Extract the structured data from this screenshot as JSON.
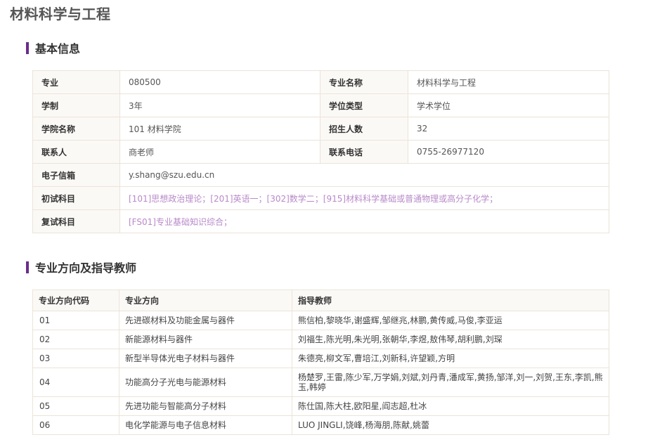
{
  "page": {
    "title": "材料科学与工程"
  },
  "basic_info": {
    "section_title": "基本信息",
    "rows": [
      {
        "l1": "专业",
        "v1": "080500",
        "l2": "专业名称",
        "v2": "材料科学与工程"
      },
      {
        "l1": "学制",
        "v1": "3年",
        "l2": "学位类型",
        "v2": "学术学位"
      },
      {
        "l1": "学院名称",
        "v1": "101 材料学院",
        "l2": "招生人数",
        "v2": "32"
      },
      {
        "l1": "联系人",
        "v1": "商老师",
        "l2": "联系电话",
        "v2": "0755-26977120"
      }
    ],
    "email_label": "电子信箱",
    "email": "y.shang@szu.edu.cn",
    "initial_exam_label": "初试科目",
    "initial_exam": "[101]思想政治理论；[201]英语一；[302]数学二；[915]材料科学基础或普通物理或高分子化学；",
    "retest_label": "复试科目",
    "retest": "[FS01]专业基础知识综合；"
  },
  "directions": {
    "section_title": "专业方向及指导教师",
    "headers": [
      "专业方向代码",
      "专业方向",
      "指导教师"
    ],
    "rows": [
      {
        "code": "01",
        "name": "先进碳材料及功能金属与器件",
        "advisors": "熊信柏,黎晓华,谢盛辉,邹继兆,林鹏,黄传威,马俊,李亚运"
      },
      {
        "code": "02",
        "name": "新能源材料与器件",
        "advisors": "刘福生,陈光明,朱光明,张朝华,李煜,敖伟琴,胡利鹏,刘琛"
      },
      {
        "code": "03",
        "name": "新型半导体光电子材料与器件",
        "advisors": "朱德亮,柳文军,曹培江,刘新科,许望颖,方明"
      },
      {
        "code": "04",
        "name": "功能高分子光电与能源材料",
        "advisors": "杨楚罗,王雷,陈少军,万学娟,刘斌,刘丹青,潘成军,黄扬,邹洋,刘一,刘贺,王东,李凯,熊玉,韩婷"
      },
      {
        "code": "05",
        "name": "先进功能与智能高分子材料",
        "advisors": "陈仕国,陈大柱,欧阳星,阎志超,杜冰"
      },
      {
        "code": "06",
        "name": "电化学能源与电子信息材料",
        "advisors": "LUO JINGLI,饶峰,杨海朋,陈献,姚蕾"
      }
    ]
  }
}
